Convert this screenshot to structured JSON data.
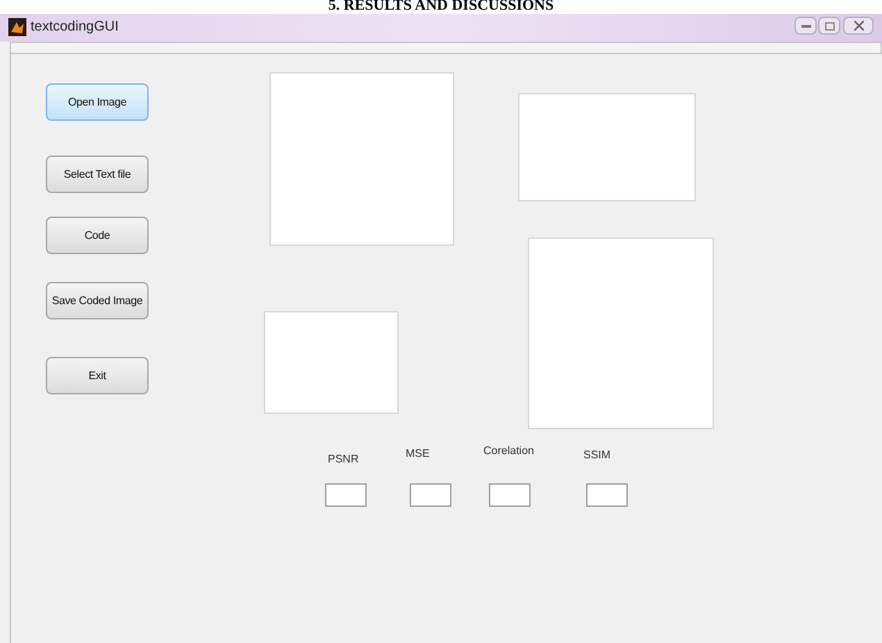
{
  "document_heading": "5. RESULTS AND DISCUSSIONS",
  "window": {
    "title": "textcodingGUI"
  },
  "buttons": [
    {
      "label": "Open Image",
      "selected": true
    },
    {
      "label": "Select Text file",
      "selected": false
    },
    {
      "label": "Code",
      "selected": false
    },
    {
      "label": "Save Coded Image",
      "selected": false
    },
    {
      "label": "Exit",
      "selected": false
    }
  ],
  "metrics": [
    {
      "label": "PSNR"
    },
    {
      "label": "MSE"
    },
    {
      "label": "Corelation"
    },
    {
      "label": "SSIM"
    }
  ]
}
